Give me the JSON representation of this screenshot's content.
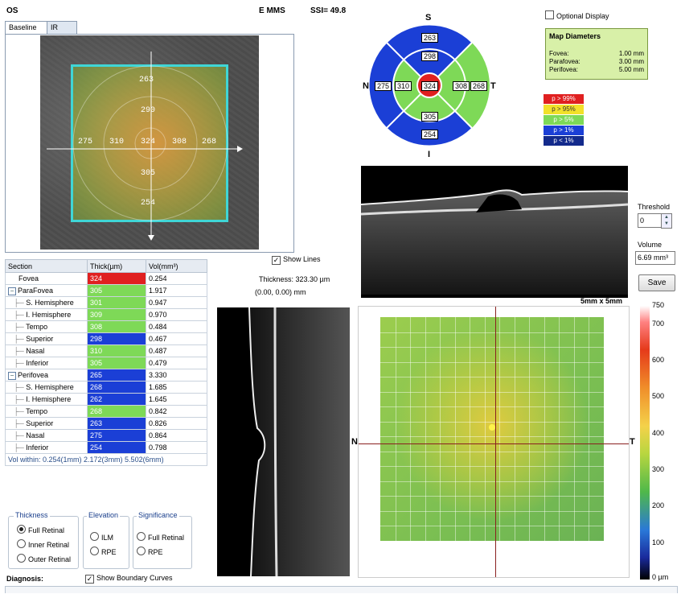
{
  "header": {
    "eye": "OS",
    "program": "E MMS",
    "ssi": "SSI= 49.8"
  },
  "tabs": [
    {
      "label": "Baseline"
    },
    {
      "label": "IR"
    }
  ],
  "fundus_values": {
    "superior_outer": "263",
    "superior_inner": "290",
    "nasal_outer": "275",
    "nasal_inner": "310",
    "center": "324",
    "temporal_inner": "308",
    "temporal_outer": "268",
    "inferior_inner": "305",
    "inferior_outer": "254"
  },
  "etdrs": {
    "S": "S",
    "N": "N",
    "T": "T",
    "I": "I",
    "superior_outer": "263",
    "superior_inner": "298",
    "nasal_outer": "275",
    "nasal_inner": "310",
    "center": "324",
    "temporal_inner": "308",
    "temporal_outer": "268",
    "inferior_inner": "305",
    "inferior_outer": "254",
    "colors": {
      "red": "#e02020",
      "green": "#7ed957",
      "blue": "#1b3fd6",
      "white": "#ffffff"
    }
  },
  "optional_display": {
    "label": "Optional Display",
    "checked": false
  },
  "map_diameters": {
    "title": "Map Diameters",
    "rows": [
      {
        "label": "Fovea:",
        "value": "1.00 mm"
      },
      {
        "label": "Parafovea:",
        "value": "3.00 mm"
      },
      {
        "label": "Perifovea:",
        "value": "5.00 mm"
      }
    ]
  },
  "significance_legend": [
    {
      "label": "p > 99%",
      "color": "#e02020"
    },
    {
      "label": "p > 95%",
      "color": "#f2e12a"
    },
    {
      "label": "p > 5%",
      "color": "#7ed957"
    },
    {
      "label": "p > 1%",
      "color": "#1b3fd6"
    },
    {
      "label": "p < 1%",
      "color": "#132a8c"
    }
  ],
  "table": {
    "headers": [
      "Section",
      "Thick(µm)",
      "Vol(mm³)"
    ],
    "rows": [
      {
        "section": "Fovea",
        "thick": "324",
        "vol": "0.254",
        "color": "#e02020",
        "indent": 1,
        "group": false
      },
      {
        "section": "ParaFovea",
        "thick": "305",
        "vol": "1.917",
        "color": "#7ed957",
        "indent": 0,
        "group": true
      },
      {
        "section": "S. Hemisphere",
        "thick": "301",
        "vol": "0.947",
        "color": "#7ed957",
        "indent": 1,
        "group": false
      },
      {
        "section": "I. Hemisphere",
        "thick": "309",
        "vol": "0.970",
        "color": "#7ed957",
        "indent": 1,
        "group": false
      },
      {
        "section": "Tempo",
        "thick": "308",
        "vol": "0.484",
        "color": "#7ed957",
        "indent": 1,
        "group": false
      },
      {
        "section": "Superior",
        "thick": "298",
        "vol": "0.467",
        "color": "#1b3fd6",
        "indent": 1,
        "group": false
      },
      {
        "section": "Nasal",
        "thick": "310",
        "vol": "0.487",
        "color": "#7ed957",
        "indent": 1,
        "group": false
      },
      {
        "section": "Inferior",
        "thick": "305",
        "vol": "0.479",
        "color": "#7ed957",
        "indent": 1,
        "group": false
      },
      {
        "section": "Perifovea",
        "thick": "265",
        "vol": "3.330",
        "color": "#1b3fd6",
        "indent": 0,
        "group": true
      },
      {
        "section": "S. Hemisphere",
        "thick": "268",
        "vol": "1.685",
        "color": "#1b3fd6",
        "indent": 1,
        "group": false
      },
      {
        "section": "I. Hemisphere",
        "thick": "262",
        "vol": "1.645",
        "color": "#1b3fd6",
        "indent": 1,
        "group": false
      },
      {
        "section": "Tempo",
        "thick": "268",
        "vol": "0.842",
        "color": "#7ed957",
        "indent": 1,
        "group": false
      },
      {
        "section": "Superior",
        "thick": "263",
        "vol": "0.826",
        "color": "#1b3fd6",
        "indent": 1,
        "group": false
      },
      {
        "section": "Nasal",
        "thick": "275",
        "vol": "0.864",
        "color": "#1b3fd6",
        "indent": 1,
        "group": false
      },
      {
        "section": "Inferior",
        "thick": "254",
        "vol": "0.798",
        "color": "#1b3fd6",
        "indent": 1,
        "group": false
      }
    ],
    "vol_within": "Vol within: 0.254(1mm) 2.172(3mm) 5.502(6mm)"
  },
  "show_lines": {
    "label": "Show Lines",
    "checked": true
  },
  "thickness_readout": "Thickness: 323.30 µm",
  "coords_readout": "(0.00, 0.00) mm",
  "threshold": {
    "label": "Threshold",
    "value": "0"
  },
  "volume": {
    "label": "Volume",
    "value": "6.69 mm³"
  },
  "save_label": "Save",
  "map_size_label": "5mm x 5mm",
  "map_axes": {
    "N": "N",
    "T": "T"
  },
  "colorbar_ticks": [
    "750",
    "700",
    "600",
    "500",
    "400",
    "300",
    "200",
    "100",
    "0 µm"
  ],
  "thickness_group": {
    "title": "Thickness",
    "options": [
      {
        "label": "Full Retinal",
        "selected": true
      },
      {
        "label": "Inner Retinal",
        "selected": false
      },
      {
        "label": "Outer Retinal",
        "selected": false
      }
    ]
  },
  "elevation_group": {
    "title": "Elevation",
    "options": [
      {
        "label": "ILM",
        "selected": false
      },
      {
        "label": "RPE",
        "selected": false
      }
    ]
  },
  "significance_group": {
    "title": "Significance",
    "options": [
      {
        "label": "Full Retinal",
        "selected": false
      },
      {
        "label": "RPE",
        "selected": false
      }
    ]
  },
  "diagnosis_label": "Diagnosis:",
  "show_boundary": {
    "label": "Show Boundary Curves",
    "checked": true
  }
}
